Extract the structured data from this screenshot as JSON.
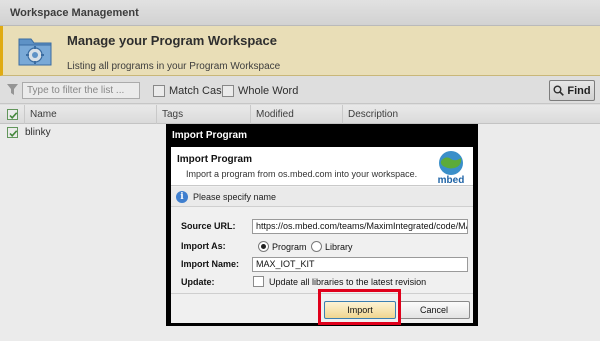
{
  "window": {
    "title": "Workspace Management"
  },
  "banner": {
    "title": "Manage your Program Workspace",
    "subtitle": "Listing all programs in your Program Workspace",
    "icon": "folder-gear-icon"
  },
  "filter": {
    "placeholder": "Type to filter the list ...",
    "match_case_label": "Match Case",
    "match_case_checked": false,
    "whole_word_label": "Whole Word",
    "whole_word_checked": false,
    "find_label": "Find"
  },
  "table": {
    "columns": [
      "Name",
      "Tags",
      "Modified",
      "Description"
    ],
    "rows": [
      {
        "name": "blinky",
        "checked": true
      }
    ]
  },
  "dialog": {
    "title": "Import Program",
    "heading": "Import Program",
    "description": "Import a program from os.mbed.com into your workspace.",
    "logo_text": "mbed",
    "info": "Please specify name",
    "source_url_label": "Source URL:",
    "source_url_value": "https://os.mbed.com/teams/MaximIntegrated/code/MAX...",
    "import_as_label": "Import As:",
    "import_as_options": [
      "Program",
      "Library"
    ],
    "import_as_selected": "Program",
    "import_name_label": "Import Name:",
    "import_name_value": "MAX_IOT_KIT",
    "update_label": "Update:",
    "update_option": "Update all libraries to the latest revision",
    "update_checked": false,
    "import_button": "Import",
    "cancel_button": "Cancel"
  },
  "colors": {
    "highlight": "#e0001b",
    "banner_bg": "#fdf0c2",
    "dialog_title_bg": "#000000"
  }
}
